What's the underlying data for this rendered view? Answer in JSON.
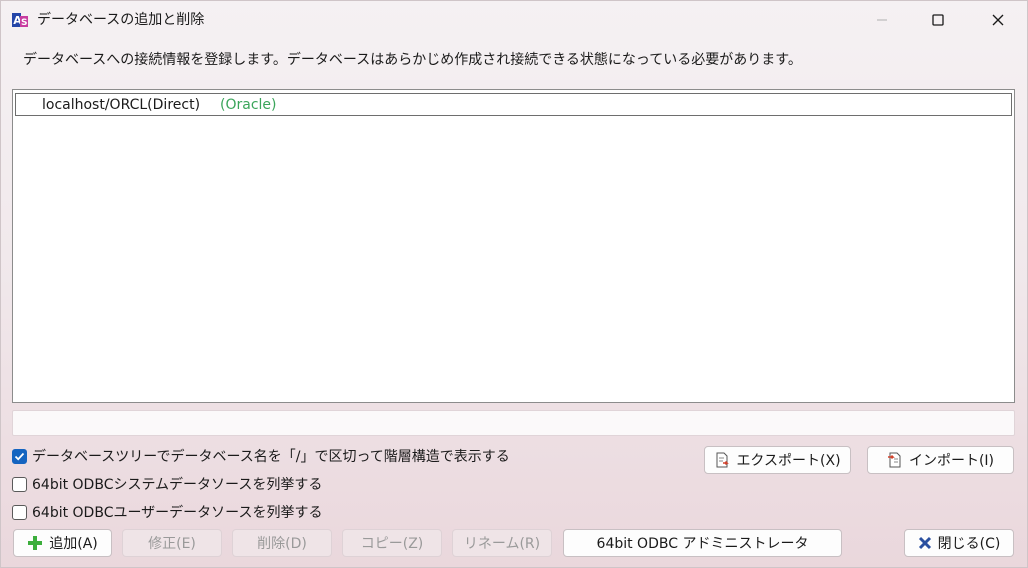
{
  "window": {
    "title": "データベースの追加と削除"
  },
  "description": "データベースへの接続情報を登録します。データベースはあらかじめ作成され接続できる状態になっている必要があります。",
  "databases": [
    {
      "name": "localhost/ORCL(Direct)",
      "type": "(Oracle)"
    }
  ],
  "status_text": "",
  "options": {
    "tree_hierarchy": {
      "label": "データベースツリーでデータベース名を「/」で区切って階層構造で表示する",
      "checked": true
    },
    "odbc_system": {
      "label": "64bit ODBCシステムデータソースを列挙する",
      "checked": false
    },
    "odbc_user": {
      "label": "64bit ODBCユーザーデータソースを列挙する",
      "checked": false
    }
  },
  "buttons": {
    "export": "エクスポート(X)",
    "import": "インポート(I)",
    "add": "追加(A)",
    "edit": "修正(E)",
    "delete": "削除(D)",
    "copy": "コピー(Z)",
    "rename": "リネーム(R)",
    "odbc_admin": "64bit ODBC アドミニストレータ",
    "close": "閉じる(C)"
  },
  "colors": {
    "accent": "#1464c0",
    "type_label": "#3aa55a",
    "add_icon": "#3cae3c",
    "close_icon": "#2a4fa0"
  }
}
